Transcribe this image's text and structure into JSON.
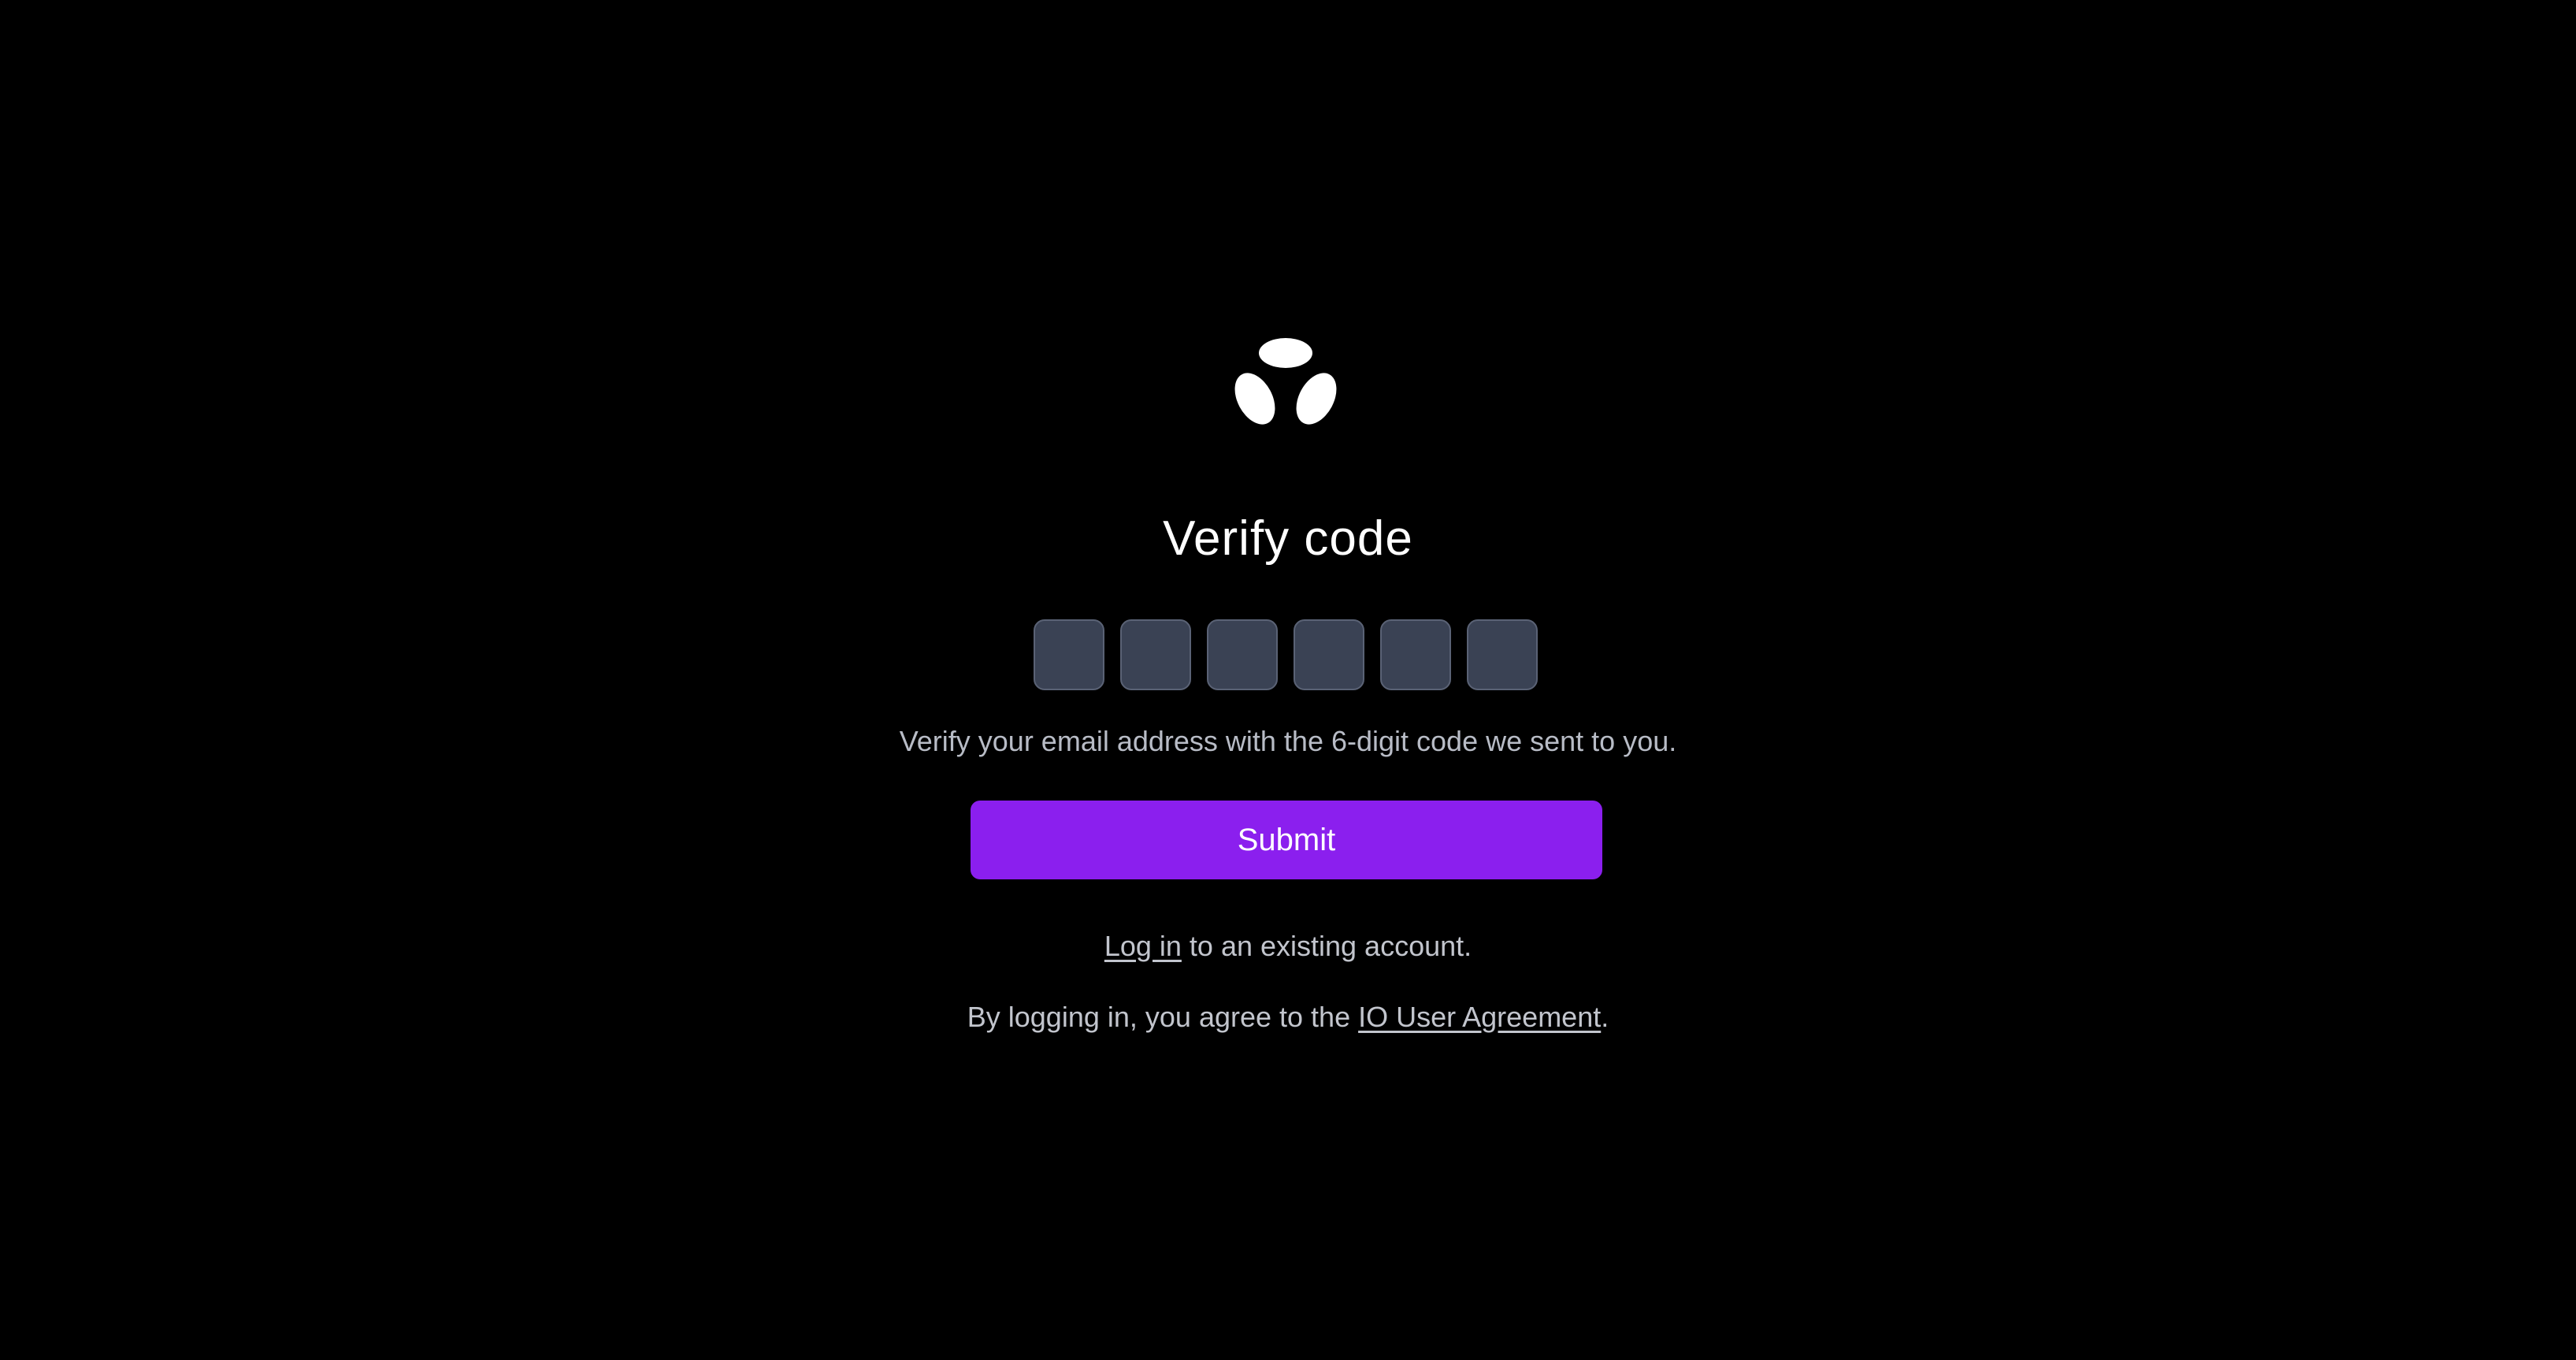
{
  "brand": {
    "logo_icon": "three-petal-logo-icon",
    "logo_color": "#ffffff"
  },
  "title": "Verify code",
  "code_inputs": {
    "count": 6,
    "values": [
      "",
      "",
      "",
      "",
      "",
      ""
    ],
    "placeholder": ""
  },
  "hint": "Verify your email address with the 6-digit code we sent to you.",
  "submit_label": "Submit",
  "login": {
    "link_text": "Log in",
    "rest_text": " to an existing account."
  },
  "agreement": {
    "prefix": "By logging in, you agree to the ",
    "link_text": "IO User Agreement",
    "suffix": "."
  },
  "colors": {
    "background": "#000000",
    "accent": "#8b1fee",
    "input_bg": "#3a4254",
    "input_border": "#5a6275",
    "muted_text": "#b8bcc6"
  }
}
